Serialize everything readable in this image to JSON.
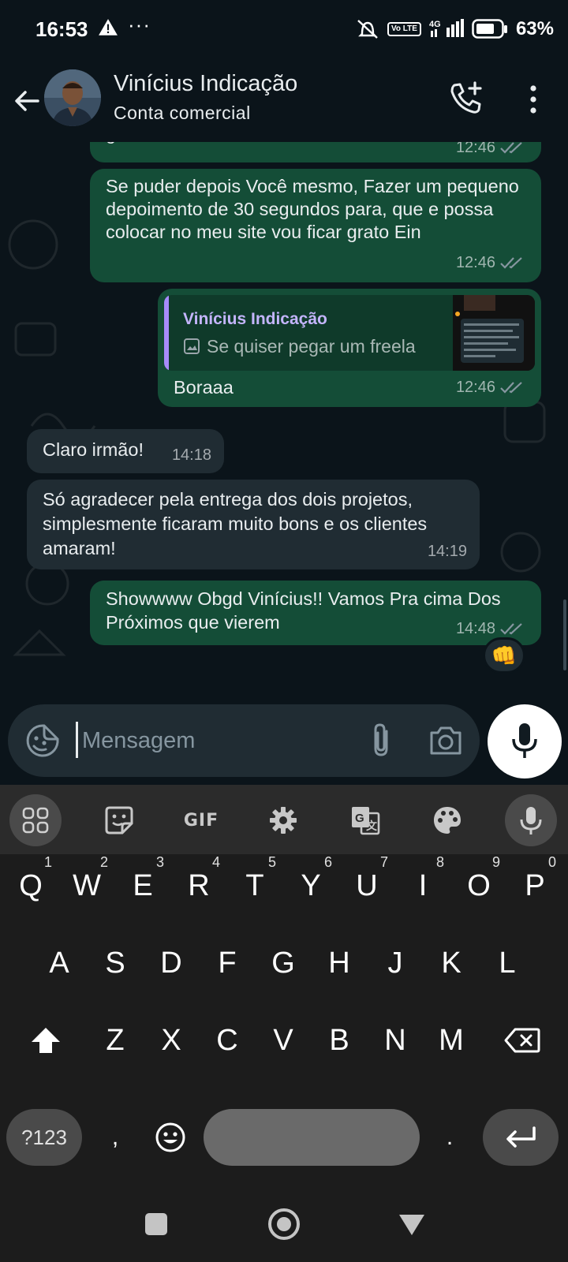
{
  "status_bar": {
    "time": "16:53",
    "network": "4G",
    "volte": "Vo LTE",
    "battery": "63%"
  },
  "header": {
    "contact_name": "Vinícius Indicação",
    "subtitle": "Conta comercial"
  },
  "messages": [
    {
      "id": "m0",
      "direction": "out",
      "text": "gostaram",
      "time": "12:46",
      "read": true
    },
    {
      "id": "m1",
      "direction": "out",
      "text": "Se puder depois Você mesmo, Fazer um pequeno depoimento de 30 segundos para, que e possa colocar no meu site vou ficar grato Ein",
      "time": "12:46",
      "read": true
    },
    {
      "id": "m2",
      "direction": "out",
      "quote": {
        "author": "Vinícius Indicação",
        "text": "Se quiser pegar um freela"
      },
      "text": "Boraaa",
      "time": "12:46",
      "read": true
    },
    {
      "id": "m3",
      "direction": "in",
      "text": "Claro irmão!",
      "time": "14:18"
    },
    {
      "id": "m4",
      "direction": "in",
      "text": "Só agradecer pela entrega dos dois projetos, simplesmente ficaram muito bons e os clientes amaram!",
      "time": "14:19"
    },
    {
      "id": "m5",
      "direction": "out",
      "text": "Showwww Obgd Vinícius!! Vamos Pra cima Dos Próximos que vierem",
      "time": "14:48",
      "read": true,
      "reaction": "👊"
    }
  ],
  "composer": {
    "placeholder": "Mensagem"
  },
  "keyboard": {
    "toolbar": {
      "gif_label": "GIF"
    },
    "row1": [
      {
        "k": "Q",
        "h": "1"
      },
      {
        "k": "W",
        "h": "2"
      },
      {
        "k": "E",
        "h": "3"
      },
      {
        "k": "R",
        "h": "4"
      },
      {
        "k": "T",
        "h": "5"
      },
      {
        "k": "Y",
        "h": "6"
      },
      {
        "k": "U",
        "h": "7"
      },
      {
        "k": "I",
        "h": "8"
      },
      {
        "k": "O",
        "h": "9"
      },
      {
        "k": "P",
        "h": "0"
      }
    ],
    "row2": [
      "A",
      "S",
      "D",
      "F",
      "G",
      "H",
      "J",
      "K",
      "L"
    ],
    "row3": [
      "Z",
      "X",
      "C",
      "V",
      "B",
      "N",
      "M"
    ],
    "symbols_label": "?123",
    "comma": ",",
    "period": "."
  }
}
